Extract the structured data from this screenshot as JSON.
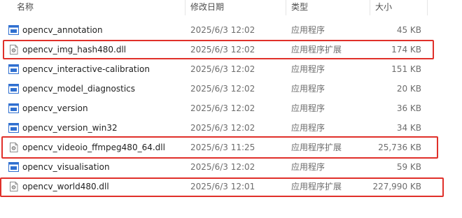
{
  "columns": {
    "name": "名称",
    "date": "修改日期",
    "type": "类型",
    "size": "大小"
  },
  "files": [
    {
      "name": "opencv_annotation",
      "date": "2025/6/3 12:02",
      "type": "应用程序",
      "size": "45 KB",
      "icon": "exe-icon",
      "highlighted": false
    },
    {
      "name": "opencv_img_hash480.dll",
      "date": "2025/6/3 12:02",
      "type": "应用程序扩展",
      "size": "174 KB",
      "icon": "dll-icon",
      "highlighted": true
    },
    {
      "name": "opencv_interactive-calibration",
      "date": "2025/6/3 12:02",
      "type": "应用程序",
      "size": "151 KB",
      "icon": "exe-icon",
      "highlighted": false
    },
    {
      "name": "opencv_model_diagnostics",
      "date": "2025/6/3 12:02",
      "type": "应用程序",
      "size": "20 KB",
      "icon": "exe-icon",
      "highlighted": false
    },
    {
      "name": "opencv_version",
      "date": "2025/6/3 12:02",
      "type": "应用程序",
      "size": "36 KB",
      "icon": "exe-icon",
      "highlighted": false
    },
    {
      "name": "opencv_version_win32",
      "date": "2025/6/3 12:02",
      "type": "应用程序",
      "size": "34 KB",
      "icon": "exe-icon",
      "highlighted": false
    },
    {
      "name": "opencv_videoio_ffmpeg480_64.dll",
      "date": "2025/6/3 11:25",
      "type": "应用程序扩展",
      "size": "25,736 KB",
      "icon": "dll-icon",
      "highlighted": true
    },
    {
      "name": "opencv_visualisation",
      "date": "2025/6/3 12:02",
      "type": "应用程序",
      "size": "59 KB",
      "icon": "exe-icon",
      "highlighted": false
    },
    {
      "name": "opencv_world480.dll",
      "date": "2025/6/3 12:01",
      "type": "应用程序扩展",
      "size": "227,990 KB",
      "icon": "dll-icon",
      "highlighted": true
    }
  ],
  "colors": {
    "highlight_border": "#e0302a",
    "exe_icon_blue": "#2f6fd0"
  }
}
